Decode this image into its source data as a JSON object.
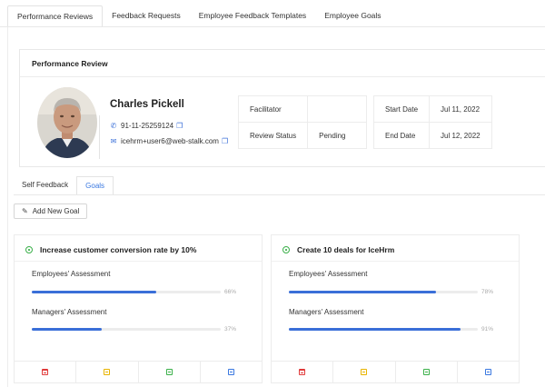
{
  "top_tabs": [
    {
      "label": "Performance Reviews",
      "active": true
    },
    {
      "label": "Feedback Requests",
      "active": false
    },
    {
      "label": "Employee Feedback Templates",
      "active": false
    },
    {
      "label": "Employee Goals",
      "active": false
    }
  ],
  "review": {
    "header": "Performance Review",
    "employee": {
      "name": "Charles Pickell",
      "phone": "91-11-25259124",
      "email": "icehrm+user6@web-stalk.com"
    },
    "facilitator_label": "Facilitator",
    "facilitator_value": "",
    "status_label": "Review Status",
    "status_value": "Pending",
    "start_label": "Start Date",
    "start_value": "Jul 11, 2022",
    "end_label": "End Date",
    "end_value": "Jul 12, 2022"
  },
  "sub_tabs": [
    {
      "label": "Self Feedback",
      "active": false
    },
    {
      "label": "Goals",
      "active": true
    }
  ],
  "add_goal_label": "Add New Goal",
  "goals": [
    {
      "title": "Increase customer conversion rate by 10%",
      "employee_label": "Employees' Assessment",
      "employee_pct": 66,
      "employee_pct_text": "66%",
      "manager_label": "Managers' Assessment",
      "manager_pct": 37,
      "manager_pct_text": "37%"
    },
    {
      "title": "Create 10 deals for IceHrm",
      "employee_label": "Employees' Assessment",
      "employee_pct": 78,
      "employee_pct_text": "78%",
      "manager_label": "Managers' Assessment",
      "manager_pct": 91,
      "manager_pct_text": "91%"
    }
  ],
  "colors": {
    "accent": "#3a6fd8",
    "success": "#3bb04a",
    "danger": "#e03a3a",
    "warning": "#e8b400"
  },
  "icons": {
    "phone": "phone-icon",
    "email": "mail-icon",
    "copy": "copy-icon",
    "add_goal": "pen-icon",
    "goal_status": "status-dot-icon",
    "actions": [
      "delete-icon",
      "edit-icon",
      "complete-icon",
      "view-icon"
    ]
  }
}
